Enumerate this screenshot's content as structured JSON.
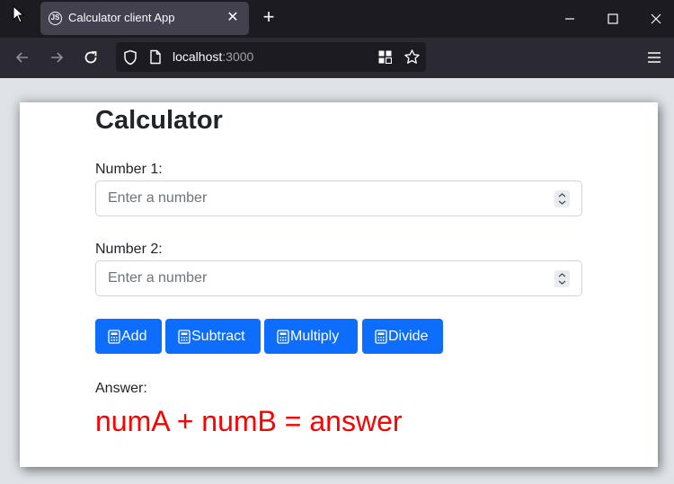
{
  "browser": {
    "tab_title": "Calculator client App",
    "url_host": "localhost",
    "url_port": ":3000"
  },
  "icons": {
    "cursor": "mouse-pointer-icon",
    "favicon": "nodejs-icon",
    "calculator": "calculator-icon"
  },
  "page": {
    "title": "Calculator",
    "number1_label": "Number 1:",
    "number2_label": "Number 2:",
    "input_placeholder": "Enter a number",
    "number1_value": "",
    "number2_value": "",
    "answer_label": "Answer:",
    "answer_text": "numA + numB = answer"
  },
  "buttons": {
    "add": "Add",
    "subtract": "Subtract",
    "multiply": "Multiply",
    "divide": "Divide"
  },
  "colors": {
    "button_primary": "#0d6efd",
    "answer_text": "#ff0000",
    "tab_bg": "#42414d",
    "chrome_bg": "#1c1b22"
  }
}
